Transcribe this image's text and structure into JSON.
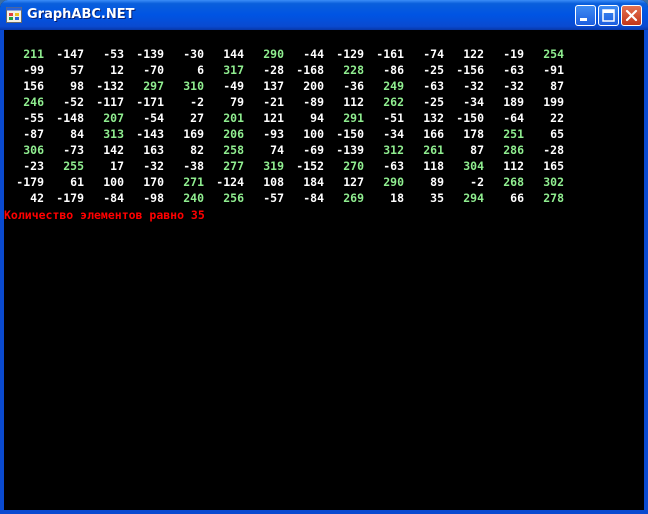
{
  "window": {
    "title": "GraphABC.NET",
    "controls": {
      "minimize": "minimize",
      "maximize": "maximize",
      "close": "close"
    }
  },
  "colors": {
    "normal_value": "#ffffff",
    "highlight_value": "#90ee90",
    "result_text": "#ff0000",
    "background": "#000000"
  },
  "matrix": [
    [
      211,
      -147,
      -53,
      -139,
      -30,
      144,
      290,
      -44,
      -129,
      -161,
      -74,
      122,
      -19,
      254
    ],
    [
      -99,
      57,
      12,
      -70,
      6,
      317,
      -28,
      -168,
      228,
      -86,
      -25,
      -156,
      -63,
      -91
    ],
    [
      156,
      98,
      -132,
      297,
      310,
      -49,
      137,
      200,
      -36,
      249,
      -63,
      -32,
      -32,
      87
    ],
    [
      246,
      -52,
      -117,
      -171,
      -2,
      79,
      -21,
      -89,
      112,
      262,
      -25,
      -34,
      189,
      199
    ],
    [
      -55,
      -148,
      207,
      -54,
      27,
      201,
      121,
      94,
      291,
      -51,
      132,
      -150,
      -64,
      22
    ],
    [
      -87,
      84,
      313,
      -143,
      169,
      206,
      -93,
      100,
      -150,
      -34,
      166,
      178,
      251,
      65
    ],
    [
      306,
      -73,
      142,
      163,
      82,
      258,
      74,
      -69,
      -139,
      312,
      261,
      87,
      286,
      -28
    ],
    [
      -23,
      255,
      17,
      -32,
      -38,
      277,
      319,
      -152,
      270,
      -63,
      118,
      304,
      112,
      165
    ],
    [
      -179,
      61,
      100,
      170,
      271,
      -124,
      108,
      184,
      127,
      290,
      89,
      -2,
      268,
      302
    ],
    [
      42,
      -179,
      -84,
      -98,
      240,
      256,
      -57,
      -84,
      269,
      18,
      35,
      294,
      66,
      278
    ]
  ],
  "highlighted": [
    [
      0,
      0
    ],
    [
      0,
      6
    ],
    [
      0,
      13
    ],
    [
      1,
      5
    ],
    [
      1,
      8
    ],
    [
      2,
      3
    ],
    [
      2,
      4
    ],
    [
      2,
      9
    ],
    [
      3,
      0
    ],
    [
      3,
      9
    ],
    [
      4,
      2
    ],
    [
      4,
      5
    ],
    [
      4,
      8
    ],
    [
      5,
      2
    ],
    [
      5,
      5
    ],
    [
      5,
      12
    ],
    [
      6,
      0
    ],
    [
      6,
      5
    ],
    [
      6,
      9
    ],
    [
      6,
      10
    ],
    [
      6,
      12
    ],
    [
      7,
      1
    ],
    [
      7,
      5
    ],
    [
      7,
      6
    ],
    [
      7,
      8
    ],
    [
      7,
      11
    ],
    [
      8,
      4
    ],
    [
      8,
      9
    ],
    [
      8,
      12
    ],
    [
      8,
      13
    ],
    [
      9,
      4
    ],
    [
      9,
      5
    ],
    [
      9,
      8
    ],
    [
      9,
      11
    ],
    [
      9,
      13
    ]
  ],
  "result": {
    "text": "Количество элементов равно 35"
  }
}
